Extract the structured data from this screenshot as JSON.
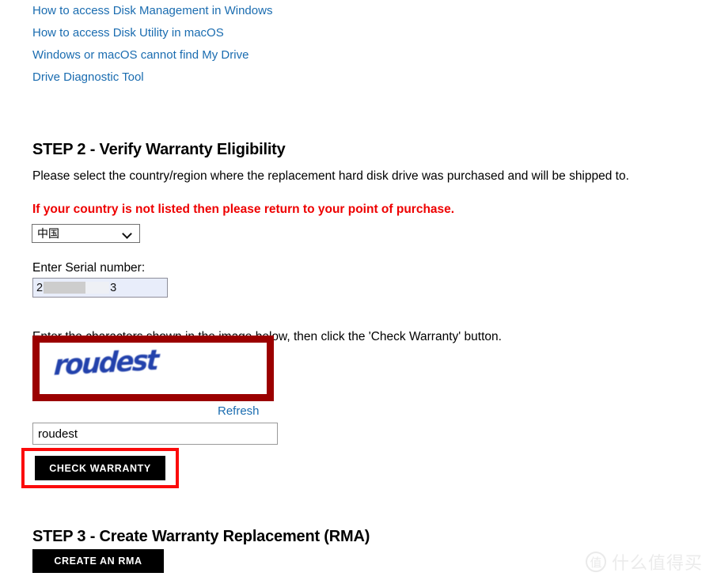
{
  "doc_links": [
    {
      "label": "How to access Disk Management in Windows"
    },
    {
      "label": "How to access Disk Utility in macOS"
    },
    {
      "label": "Windows or macOS cannot find My Drive"
    },
    {
      "label": "Drive Diagnostic Tool"
    }
  ],
  "step2": {
    "heading": "STEP 2 - Verify Warranty Eligibility",
    "paragraph": "Please select the country/region where the replacement hard disk drive was purchased and will be shipped to.",
    "warning": "If your country is not listed then please return to your point of purchase.",
    "country_select": {
      "selected": "中国",
      "icon": "chevron-down-icon"
    },
    "serial_label": "Enter Serial number:",
    "serial_value_prefix": "2",
    "serial_value_suffix": "3",
    "captcha_instruction": "Enter the characters shown in the image below, then click the 'Check Warranty' button.",
    "captcha_image_text": "roudest",
    "refresh_label": "Refresh",
    "captcha_input_value": "roudest",
    "check_warranty_label": "CHECK WARRANTY"
  },
  "step3": {
    "heading": "STEP 3 - Create Warranty Replacement (RMA)",
    "create_rma_label": "CREATE AN RMA"
  },
  "watermark": {
    "badge": "值",
    "text": "什么值得买"
  },
  "colors": {
    "link_blue": "#1a6cb0",
    "warning_red": "#ee0000",
    "annotation_red_bright": "#fb0b0b",
    "annotation_red_dark": "#9b0000",
    "captcha_blue": "#2342ac",
    "button_black": "#000000",
    "serial_autofill": "#e8edfa"
  }
}
